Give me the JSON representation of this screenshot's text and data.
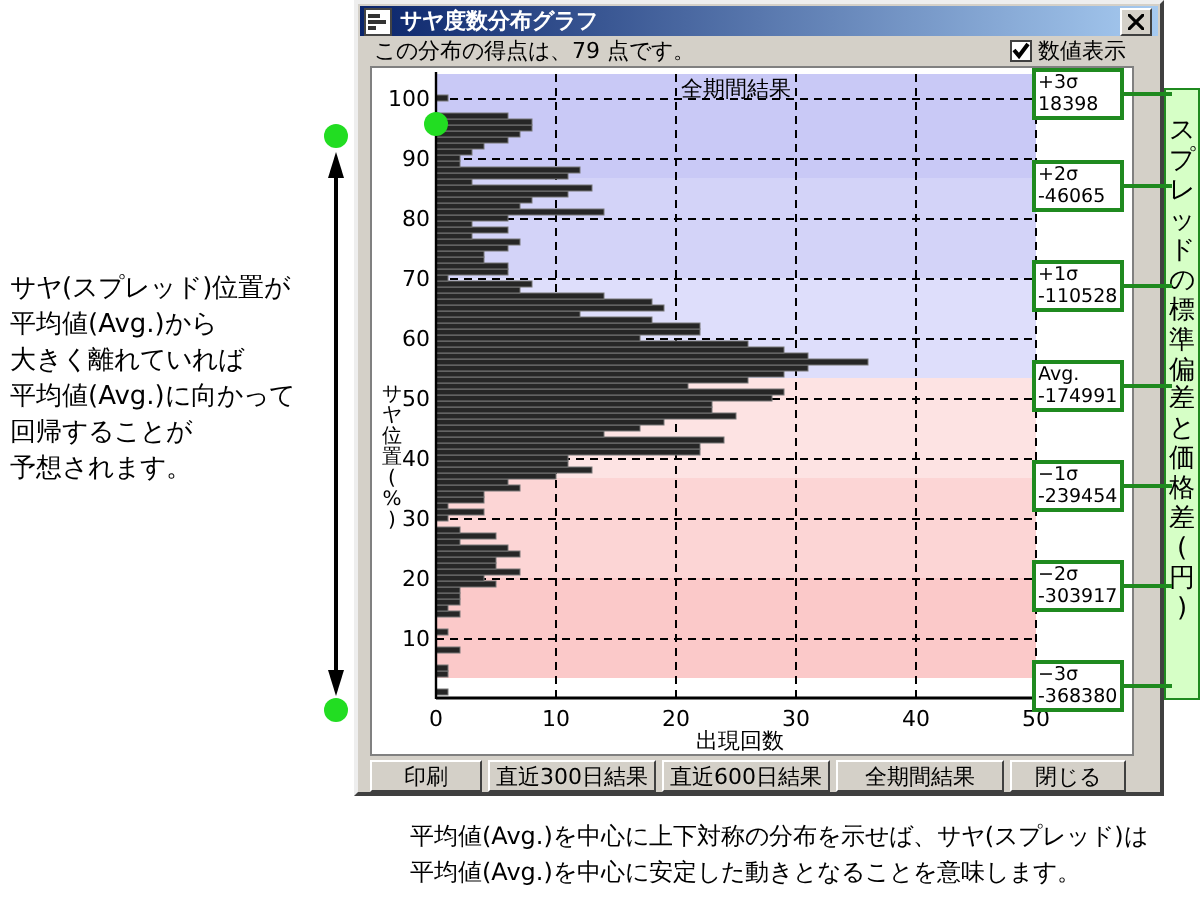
{
  "annotation_lines": [
    "サヤ(スプレッド)位置が",
    "平均値(Avg.)から",
    "大きく離れていれば",
    "平均値(Avg.)に向かって",
    "回帰することが",
    "予想されます。"
  ],
  "window": {
    "title": "サヤ度数分布グラフ",
    "score_text": "この分布の得点は、79 点です。",
    "checkbox": {
      "label": "数値表示",
      "checked": true
    },
    "chart_data": {
      "type": "bar",
      "orientation": "horizontal",
      "title": "全期間結果",
      "xlabel": "出現回数",
      "ylabel": "サヤ位置(%)",
      "grid": true,
      "x": [
        0,
        1,
        2,
        3,
        4,
        5,
        6,
        7,
        8,
        9,
        10,
        11,
        12,
        13,
        14,
        15,
        16,
        17,
        18,
        19,
        20,
        21,
        22,
        23,
        24,
        25,
        26,
        27,
        28,
        29,
        30,
        31,
        32,
        33,
        34,
        35,
        36,
        37,
        38,
        39,
        40,
        41,
        42,
        43,
        44,
        45,
        46,
        47,
        48,
        49,
        50,
        51,
        52,
        53,
        54,
        55,
        56,
        57,
        58,
        59,
        60,
        61,
        62,
        63,
        64,
        65,
        66,
        67,
        68,
        69,
        70,
        71,
        72,
        73,
        74,
        75,
        76,
        77,
        78,
        79,
        80,
        81,
        82,
        83,
        84,
        85,
        86,
        87,
        88,
        89,
        90,
        91,
        92,
        93,
        94,
        95,
        96,
        97,
        98,
        99,
        100
      ],
      "values": [
        0,
        1,
        0,
        0,
        1,
        1,
        0,
        0,
        2,
        0,
        0,
        1,
        0,
        0,
        2,
        1,
        2,
        2,
        2,
        5,
        4,
        7,
        5,
        5,
        7,
        6,
        2,
        5,
        2,
        0,
        1,
        4,
        1,
        4,
        4,
        7,
        6,
        10,
        13,
        11,
        11,
        22,
        22,
        24,
        14,
        17,
        19,
        25,
        23,
        23,
        28,
        29,
        21,
        26,
        29,
        31,
        36,
        31,
        29,
        26,
        17,
        22,
        22,
        18,
        12,
        19,
        18,
        14,
        7,
        8,
        1,
        6,
        6,
        4,
        4,
        6,
        7,
        3,
        6,
        3,
        6,
        14,
        7,
        8,
        11,
        13,
        3,
        11,
        12,
        2,
        2,
        3,
        4,
        6,
        7,
        8,
        8,
        6,
        0,
        0,
        1
      ],
      "xlim": [
        0,
        50
      ],
      "xticks": [
        0,
        10,
        20,
        30,
        40,
        50
      ],
      "ylim": [
        0,
        104
      ],
      "yticks": [
        10,
        20,
        30,
        40,
        50,
        60,
        70,
        80,
        90,
        100
      ]
    },
    "buttons": [
      "印刷",
      "直近300日結果",
      "直近600日結果",
      "全期間結果",
      "閉じる"
    ]
  },
  "sigma_labels": [
    {
      "label": "+3σ",
      "value": "18398"
    },
    {
      "label": "+2σ",
      "value": "-46065"
    },
    {
      "label": "+1σ",
      "value": "-110528"
    },
    {
      "label": "Avg.",
      "value": "-174991"
    },
    {
      "label": "−1σ",
      "value": "-239454"
    },
    {
      "label": "−2σ",
      "value": "-303917"
    },
    {
      "label": "−3σ",
      "value": "-368380"
    }
  ],
  "side_label": "スプレッドの標準偏差と価格差(円)",
  "caption_lines": [
    "平均値(Avg.)を中心に上下対称の分布を示せば、サヤ(スプレッド)は",
    "平均値(Avg.)を中心に安定した動きとなることを意味します。"
  ]
}
